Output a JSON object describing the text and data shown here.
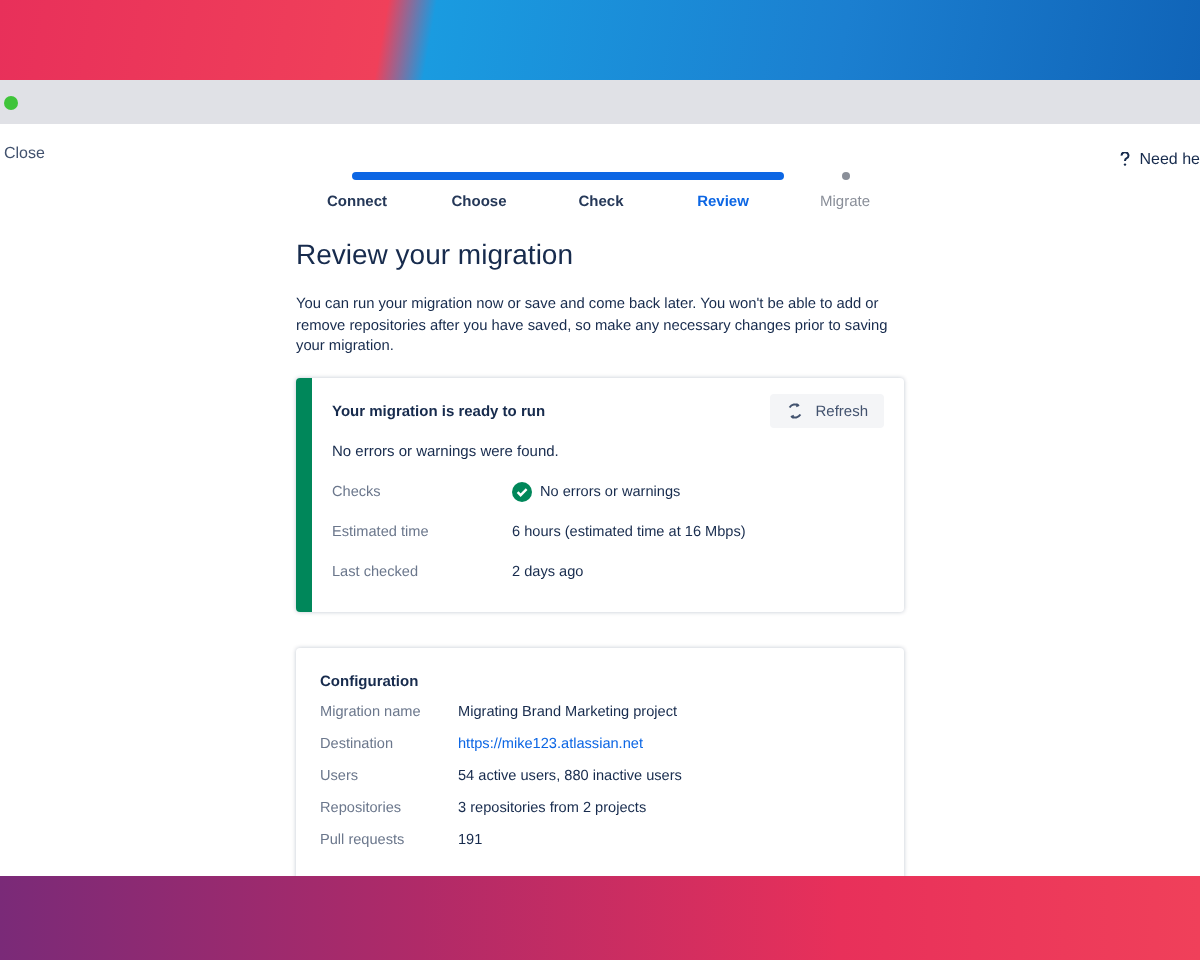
{
  "window": {
    "close_label": "Close",
    "help_label": "Need he"
  },
  "steps": [
    {
      "label": "Connect",
      "completed": true,
      "selected": false
    },
    {
      "label": "Choose",
      "completed": true,
      "selected": false
    },
    {
      "label": "Check",
      "completed": true,
      "selected": false
    },
    {
      "label": "Review",
      "completed": true,
      "selected": true
    },
    {
      "label": "Migrate",
      "completed": false,
      "selected": false
    }
  ],
  "title": "Review your migration",
  "intro": "You can run your migration now or save and come back later. You won't be able to add or remove repositories after you have saved, so make any necessary changes prior to saving your migration.",
  "status_card": {
    "title": "Your migration is ready to run",
    "refresh_label": "Refresh",
    "message": "No errors or warnings were found.",
    "rows": [
      {
        "label": "Checks",
        "value": "No errors or warnings",
        "kind": "check"
      },
      {
        "label": "Estimated time",
        "value": "6 hours (estimated time at 16 Mbps)",
        "kind": "text"
      },
      {
        "label": "Last checked",
        "value": "2 days ago",
        "kind": "text"
      }
    ]
  },
  "configuration": {
    "title": "Configuration",
    "rows": [
      {
        "label": "Migration name",
        "value": "Migrating Brand Marketing project",
        "kind": "text"
      },
      {
        "label": "Destination",
        "value": "https://mike123.atlassian.net",
        "kind": "link"
      },
      {
        "label": "Users",
        "value": "54 active users, 880 inactive users",
        "kind": "text"
      },
      {
        "label": "Repositories",
        "value": "3 repositories from 2 projects",
        "kind": "text"
      },
      {
        "label": "Pull requests",
        "value": "191",
        "kind": "text"
      }
    ]
  }
}
